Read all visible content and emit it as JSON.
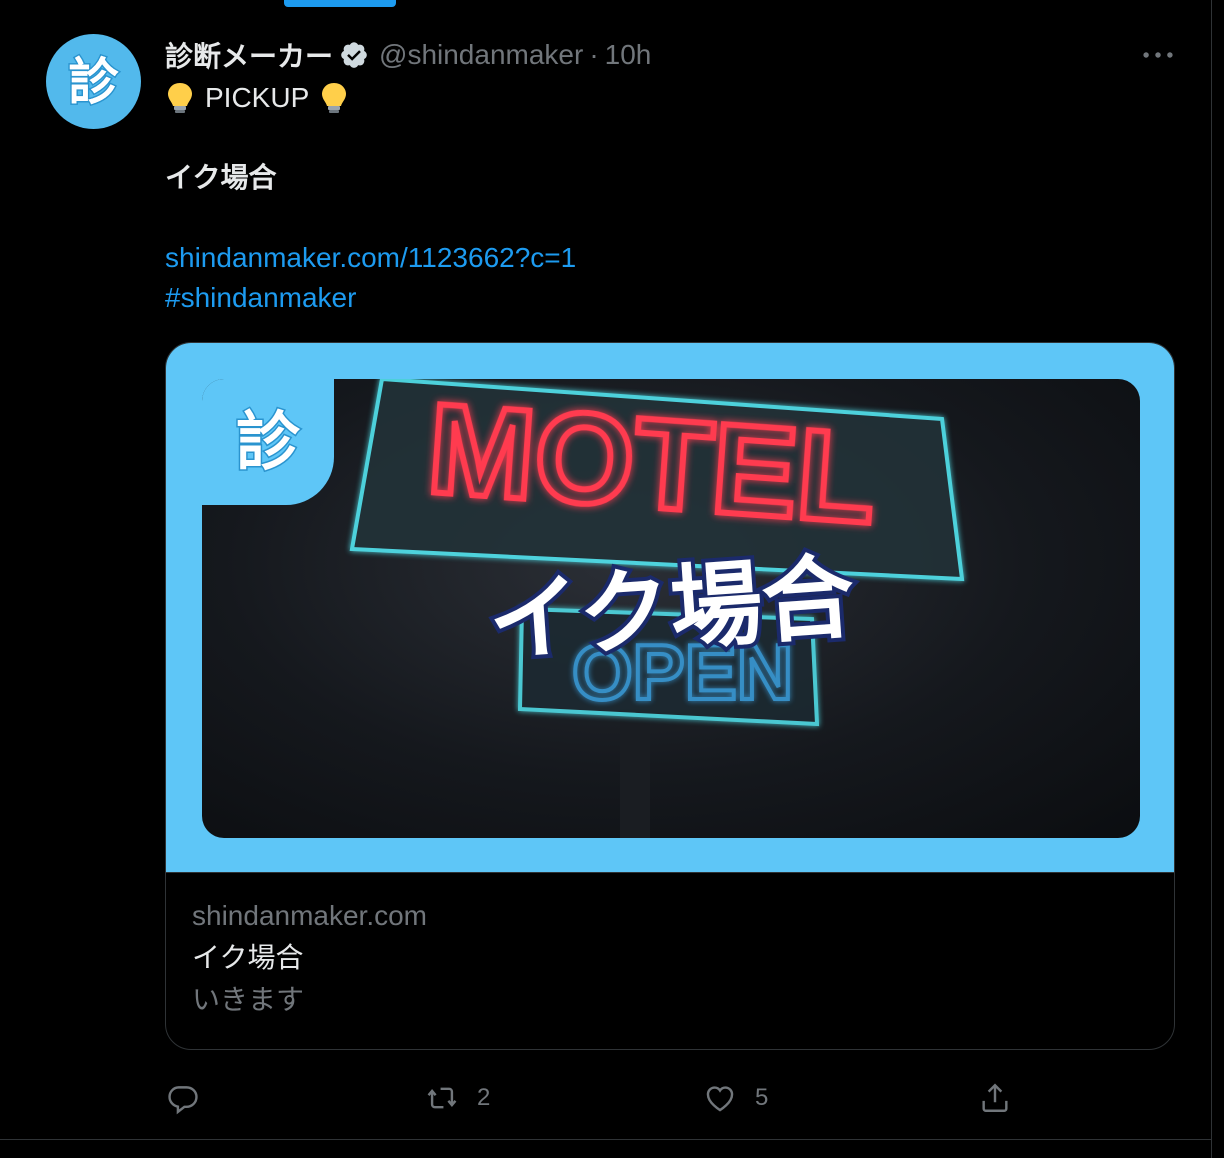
{
  "tweet": {
    "display_name": "診断メーカー",
    "handle": "@shindanmaker",
    "separator": "·",
    "time": "10h",
    "avatar_glyph": "診",
    "lines": {
      "pickup": "PICKUP",
      "title": "イク場合",
      "link": "shindanmaker.com/1123662?c=1",
      "hashtag": "#shindanmaker"
    }
  },
  "card": {
    "badge_glyph": "診",
    "image_sign_text": "MOTEL",
    "image_sub_sign_text": "OPEN",
    "image_overlay_text": "イク場合",
    "domain": "shindanmaker.com",
    "title": "イク場合",
    "description": "いきます"
  },
  "actions": {
    "reply_count": "",
    "retweet_count": "2",
    "like_count": "5"
  },
  "colors": {
    "accent": "#1d9bf0",
    "card_frame": "#5ec6f7",
    "neon_red": "#ff3b4f",
    "neon_cyan": "#53e5f0",
    "overlay_text_fill": "#ffffff",
    "overlay_text_stroke": "#1b2a6b"
  },
  "icons": [
    "verified-badge-icon",
    "lightbulb-icon",
    "more-icon",
    "reply-icon",
    "retweet-icon",
    "like-icon",
    "share-icon"
  ]
}
